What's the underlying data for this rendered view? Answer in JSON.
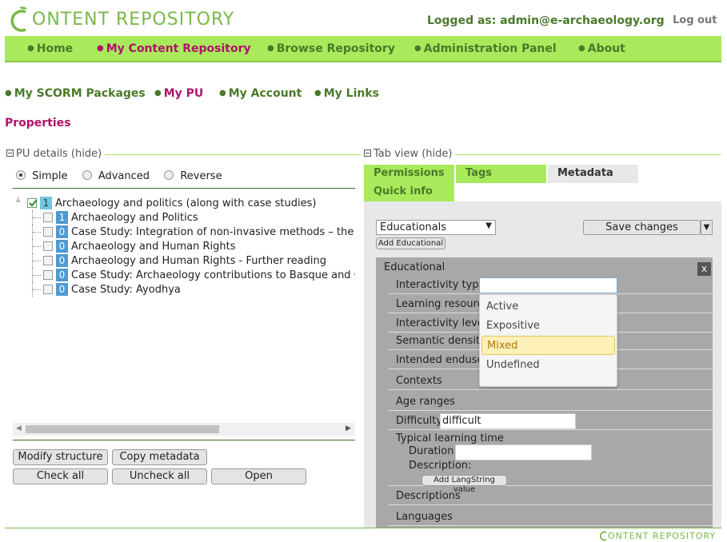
{
  "header": {
    "logo_text": "ONTENT REPOSITORY",
    "logged_as": "Logged as: admin@e-archaeology.org",
    "logout": "Log out"
  },
  "main_nav": [
    "Home",
    "My Content Repository",
    "Browse Repository",
    "Administration Panel",
    "About"
  ],
  "main_nav_active": "My Content Repository",
  "sub_nav": [
    "My SCORM Packages",
    "My PU",
    "My Account",
    "My Links"
  ],
  "sub_nav_active": "My PU",
  "page_title": "Properties",
  "pu_details": {
    "legend": "PU details (hide)",
    "modes": [
      "Simple",
      "Advanced",
      "Reverse"
    ],
    "selected_mode": "Simple",
    "tree": [
      {
        "num": "1",
        "label": "Archaeology and politics (along with case studies)",
        "checked": true,
        "level": 0
      },
      {
        "num": "1",
        "label": "Archaeology and Politics",
        "checked": false,
        "level": 1
      },
      {
        "num": "0",
        "label": "Case Study: Integration of non-invasive methods – the exa",
        "checked": false,
        "level": 1
      },
      {
        "num": "0",
        "label": "Archaeology and Human Rights",
        "checked": false,
        "level": 1
      },
      {
        "num": "0",
        "label": "Archaeology and Human Rights - Further reading",
        "checked": false,
        "level": 1
      },
      {
        "num": "0",
        "label": "Case Study: Archaeology contributions to Basque and Cata",
        "checked": false,
        "level": 1
      },
      {
        "num": "0",
        "label": "Case Study: Ayodhya",
        "checked": false,
        "level": 1
      }
    ],
    "buttons": {
      "modify": "Modify structure",
      "copy": "Copy metadata",
      "check_all": "Check all",
      "uncheck_all": "Uncheck all",
      "open": "Open"
    }
  },
  "tab_view": {
    "legend": "Tab view (hide)",
    "tabs": [
      "Permissions",
      "Tags",
      "Metadata",
      "Quick info"
    ],
    "active_tab": "Metadata",
    "category_select": "Educationals",
    "add_button": "Add Educational",
    "save": "Save changes",
    "section_title": "Educational",
    "close": "x",
    "fields": {
      "interactivity_type": "Interactivity type",
      "learning_resource": "Learning resource",
      "interactivity_level": "Interactivity level",
      "semantic_density": "Semantic density",
      "intended_enduser": "Intended enduser",
      "contexts": "Contexts",
      "age_ranges": "Age ranges",
      "difficulty": "Difficulty",
      "difficulty_value": "difficult",
      "typical_learning_time": "Typical learning time",
      "duration": "Duration:",
      "description": "Description:",
      "add_langstring": "Add LangString value",
      "descriptions": "Descriptions",
      "languages": "Languages"
    },
    "dropdown_options": [
      "Active",
      "Expositive",
      "Mixed",
      "Undefined"
    ],
    "dropdown_highlighted": "Mixed"
  },
  "colors": {
    "accent": "#a9ea5c",
    "active": "#b0126a",
    "nav_text": "#4a7a2a"
  }
}
